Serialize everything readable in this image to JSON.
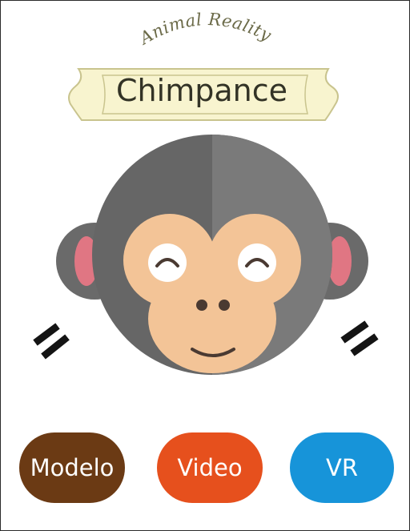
{
  "app": {
    "subtitle": "Animal Reality",
    "title": "Chimpance"
  },
  "colors": {
    "banner_fill": "#f8f4cf",
    "banner_stroke": "#c9c48e",
    "fur_dark": "#666666",
    "fur_light": "#7a7a7a",
    "skin": "#f3c497",
    "ear_inner": "#e07683",
    "eye_white": "#ffffff",
    "feature_dark": "#4a3a32",
    "dash_color": "#141414",
    "modelo": "#6b3a14",
    "video": "#e6501d",
    "vr": "#1794d9"
  },
  "illustration": {
    "name": "chimpanzee-face-icon"
  },
  "buttons": {
    "modelo": "Modelo",
    "video": "Video",
    "vr": "VR"
  }
}
